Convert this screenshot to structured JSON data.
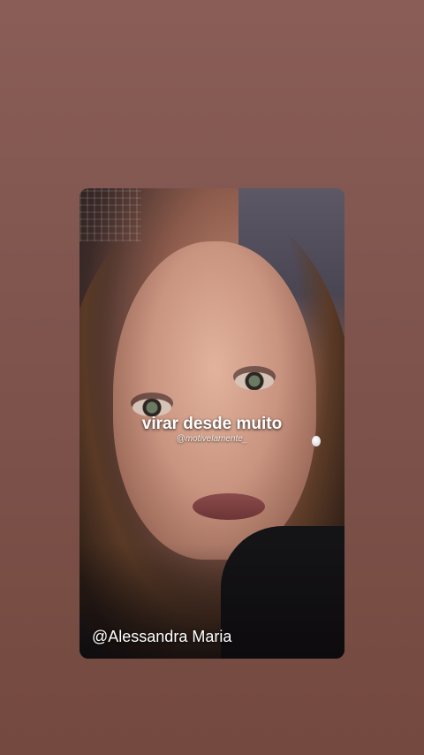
{
  "story": {
    "caption": "virar desde muito",
    "watermark": "@motivelamente_",
    "credit": "@Alessandra Maria"
  }
}
